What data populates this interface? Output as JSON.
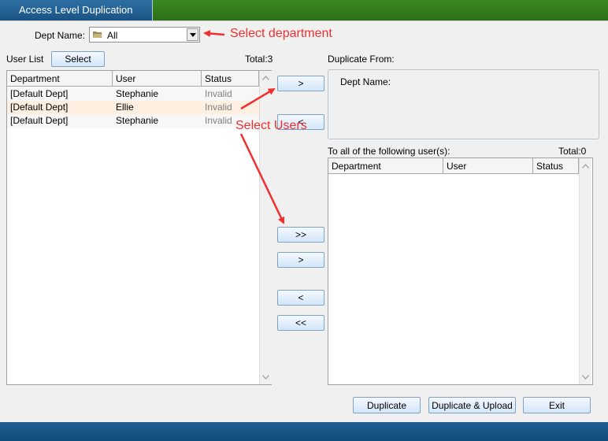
{
  "window": {
    "title": "Access Level Duplication"
  },
  "dept": {
    "label": "Dept Name:",
    "value": "All"
  },
  "user_list": {
    "label": "User List",
    "select_button": "Select",
    "total": "Total:3",
    "columns": [
      "Department",
      "User",
      "Status"
    ],
    "rows": [
      {
        "department": "[Default Dept]",
        "user": "Stephanie",
        "status": "Invalid"
      },
      {
        "department": "[Default Dept]",
        "user": "Ellie",
        "status": "Invalid"
      },
      {
        "department": "[Default Dept]",
        "user": "Stephanie",
        "status": "Invalid"
      }
    ]
  },
  "transfer_buttons": {
    "from_add": ">",
    "from_remove": "<",
    "add_all": ">>",
    "add": ">",
    "remove": "<",
    "remove_all": "<<"
  },
  "duplicate_from": {
    "label": "Duplicate From:",
    "dept_label": "Dept Name:"
  },
  "target_list": {
    "label": "To all of the following user(s):",
    "total": "Total:0",
    "columns": [
      "Department",
      "User",
      "Status"
    ]
  },
  "actions": {
    "duplicate": "Duplicate",
    "duplicate_upload": "Duplicate & Upload",
    "exit": "Exit"
  },
  "annotations": {
    "select_department": "Select department",
    "select_users": "Select Users"
  },
  "colors": {
    "annotation": "#f03030",
    "title_green": "#2b6e17",
    "title_blue": "#1a5384",
    "highlight_row": "#fdf0e0"
  }
}
